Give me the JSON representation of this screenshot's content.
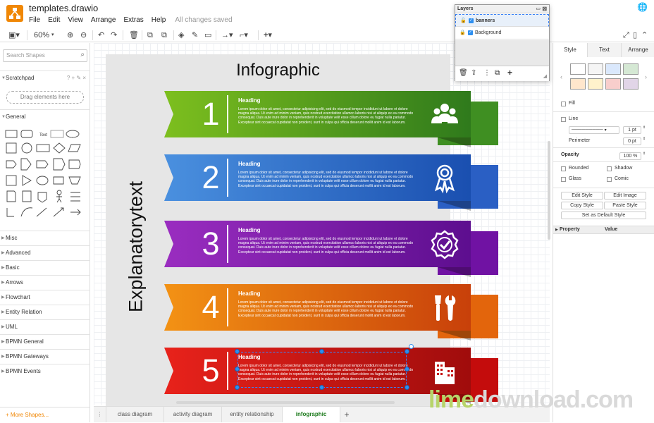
{
  "app": {
    "title": "templates.drawio",
    "menu": [
      "File",
      "Edit",
      "View",
      "Arrange",
      "Extras",
      "Help"
    ],
    "status": "All changes saved"
  },
  "toolbar": {
    "zoom": "60%"
  },
  "sidebar": {
    "search_placeholder": "Search Shapes",
    "scratchpad": "Scratchpad",
    "scratch_icons": "? + ✎ ×",
    "drag_hint": "Drag elements here",
    "general": "General",
    "sections": [
      "Misc",
      "Advanced",
      "Basic",
      "Arrows",
      "Flowchart",
      "Entity Relation",
      "UML",
      "BPMN General",
      "BPMN Gateways",
      "BPMN Events"
    ],
    "more_shapes": "+ More Shapes..."
  },
  "diagram": {
    "title": "Infographic",
    "side_text": "Explanatorytext",
    "banners": [
      {
        "number": "1",
        "heading": "Heading",
        "icon": "people-icon",
        "color": "#6fae1e"
      },
      {
        "number": "2",
        "heading": "Heading",
        "icon": "award-ribbon-icon",
        "color": "#3f85d6"
      },
      {
        "number": "3",
        "heading": "Heading",
        "icon": "badge-check-icon",
        "color": "#8b18b0"
      },
      {
        "number": "4",
        "heading": "Heading",
        "icon": "tools-icon",
        "color": "#e8780e"
      },
      {
        "number": "5",
        "heading": "Heading",
        "icon": "buildings-icon",
        "color": "#d8130f"
      }
    ],
    "body_text": "Lorem ipsum dolor sit amet, consectetur adipisicing elit, sed do eiusmod tempor incididunt ut labore et dolore magna aliqua. Ut enim ad minim veniam, quis nostrud exercitation ullamco laboris nisi ut aliquip ex ea commodo consequat. Duis aute irure dolor in reprehenderit in voluptate velit esse cillum dolore eu fugiat nulla pariatur. Excepteur sint occaecat cupidatat non proident, sunt in culpa qui officia deserunt mollit anim id est laborum."
  },
  "pages": {
    "tabs": [
      "class diagram",
      "activity diagram",
      "entity relationship",
      "infographic"
    ],
    "active": "infographic"
  },
  "format_panel": {
    "tabs": [
      "Style",
      "Text",
      "Arrange"
    ],
    "swatches": [
      "#ffffff",
      "#f5f5f5",
      "#dae8fc",
      "#d5e8d4",
      "#ffe6cc",
      "#fff2cc",
      "#f8cecc",
      "#e1d5e7"
    ],
    "fill": "Fill",
    "line": "Line",
    "line_width": "1 pt",
    "perimeter": "Perimeter",
    "perimeter_value": "0 pt",
    "opacity": "Opacity",
    "opacity_value": "100 %",
    "rounded": "Rounded",
    "shadow": "Shadow",
    "glass": "Glass",
    "comic": "Comic",
    "edit_style": "Edit Style",
    "edit_image": "Edit Image",
    "copy_style": "Copy Style",
    "paste_style": "Paste Style",
    "set_default": "Set as Default Style",
    "property": "Property",
    "value": "Value"
  },
  "layers": {
    "title": "Layers",
    "items": [
      {
        "name": "banners",
        "checked": true,
        "selected": true
      },
      {
        "name": "Background",
        "checked": true,
        "selected": false
      }
    ]
  },
  "watermark": {
    "part1": "lime",
    "part2": "download.com"
  }
}
